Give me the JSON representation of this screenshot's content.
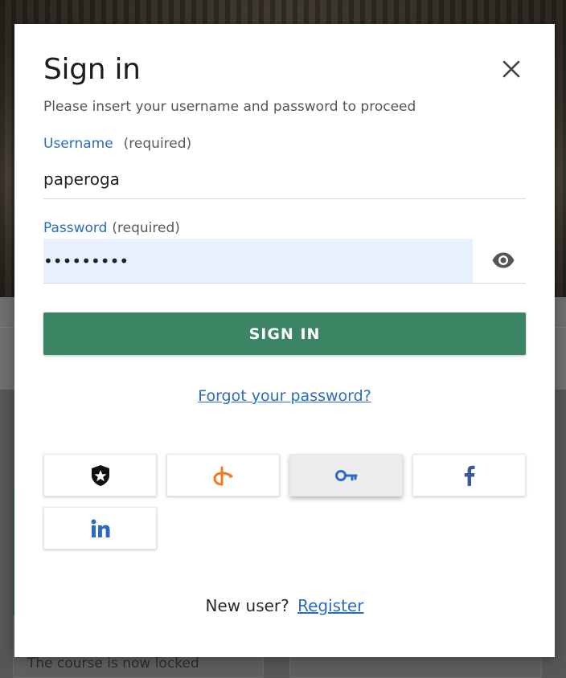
{
  "background": {
    "locked_notice": "The course is now locked"
  },
  "modal": {
    "title": "Sign in",
    "subtitle": "Please insert your username and password to proceed",
    "close_icon": "close-icon"
  },
  "username": {
    "label": "Username",
    "required_text": "(required)",
    "value": "paperoga"
  },
  "password": {
    "label": "Password",
    "required_text": "(required)",
    "value": "•••••••••",
    "toggle_icon": "eye-icon"
  },
  "signin_button": {
    "label": "SIGN IN"
  },
  "forgot_link": {
    "label": "Forgot your password?"
  },
  "social_logins": [
    {
      "icon": "auth0-icon",
      "color": "#111111"
    },
    {
      "icon": "openid-connect-icon",
      "color": "#f47920"
    },
    {
      "icon": "key-icon",
      "color": "#2a6cc4"
    },
    {
      "icon": "facebook-icon",
      "color": "#3b5998"
    },
    {
      "icon": "linkedin-icon",
      "color": "#2a6cc4"
    }
  ],
  "register": {
    "prompt": "New user?",
    "link_label": "Register"
  },
  "colors": {
    "accent_blue": "#2a6cc4",
    "primary_green": "#3c8564",
    "autofill_bg": "#e8f0fe"
  }
}
